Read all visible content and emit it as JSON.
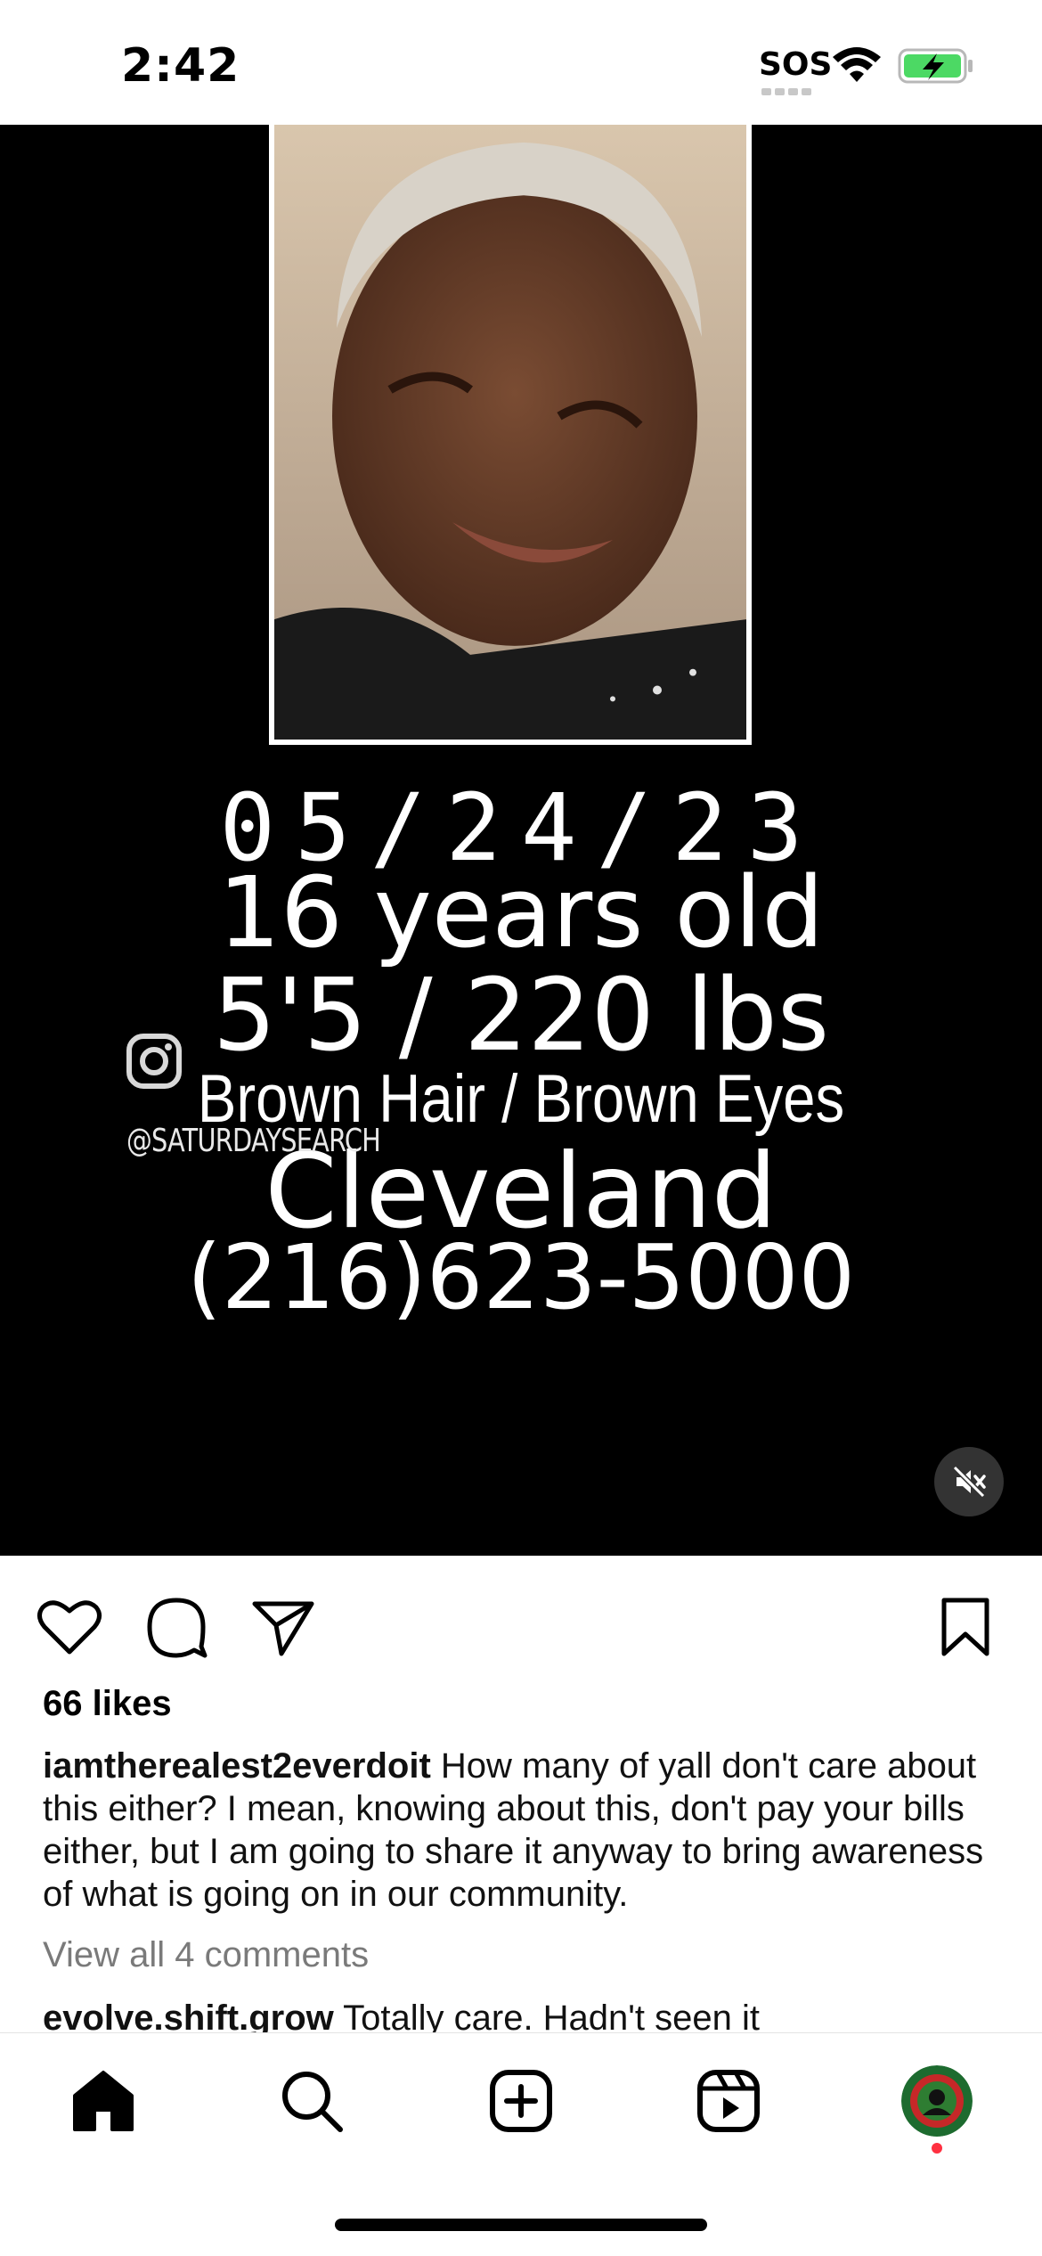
{
  "status_bar": {
    "time": "2:42",
    "sos": "SOS",
    "wifi_icon": "wifi-icon",
    "battery_icon": "battery-charging-icon",
    "battery_color": "#4cd964"
  },
  "post_media": {
    "date": "05/24/23",
    "age": "16 years old",
    "height_weight": "5'5 / 220 lbs",
    "hair_eyes": "Brown Hair / Brown Eyes",
    "city": "Cleveland",
    "phone": "(216)623-5000",
    "watermark_handle": "@SATURDAYSEARCH",
    "watermark_icon": "instagram-icon",
    "mute_icon": "speaker-muted-icon"
  },
  "actions": {
    "like_icon": "heart-icon",
    "comment_icon": "comment-bubble-icon",
    "share_icon": "paper-plane-icon",
    "save_icon": "bookmark-icon"
  },
  "likes": "66 likes",
  "caption": {
    "username": "iamtherealest2everdoit",
    "text": " How many of yall don't care about this either? I mean, knowing about this, don't pay your bills either, but I am going to share it anyway to bring awareness of what is going on in our community."
  },
  "view_comments": "View all 4 comments",
  "comment_preview": {
    "username": "evolve.shift.grow",
    "text": " Totally care. Hadn't seen it"
  },
  "bottom_nav": {
    "items": [
      "home-icon",
      "search-icon",
      "create-post-icon",
      "reels-icon",
      "profile-avatar"
    ],
    "notification_color": "#ff3040"
  }
}
